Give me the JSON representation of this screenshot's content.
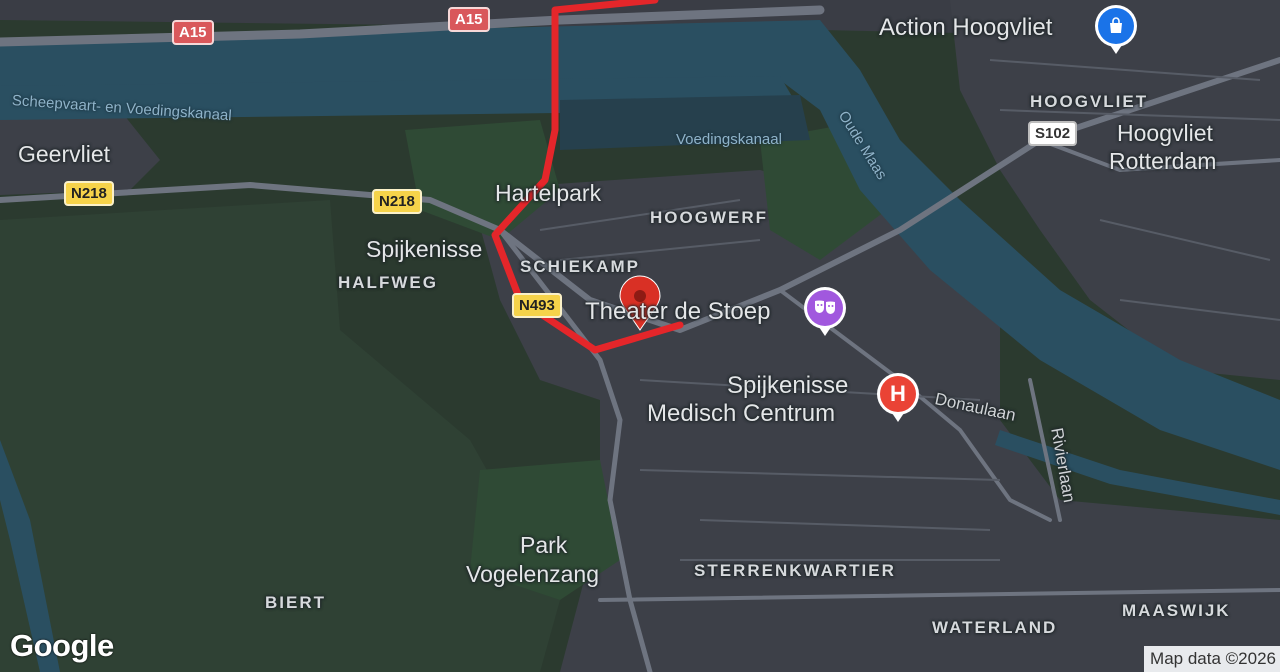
{
  "map": {
    "attribution": "Map data ©2026",
    "logo": "Google",
    "colors": {
      "land": "#2b3a2f",
      "urban": "#3d4048",
      "water": "#2a4f61",
      "road": "#6e7480",
      "route": "#e4262a",
      "marker": "#d93025"
    },
    "places": {
      "geervliet": "Geervliet",
      "hartelpark": "Hartelpark",
      "spijkenisse": "Spijkenisse",
      "hoogvliet_rotterdam_1": "Hoogvliet",
      "hoogvliet_rotterdam_2": "Rotterdam",
      "park_vogelenzang_1": "Park",
      "park_vogelenzang_2": "Vogelenzang"
    },
    "districts": {
      "halfweg": "HALFWEG",
      "schiekamp": "SCHIEKAMP",
      "hoogwerf": "HOOGWERF",
      "hoogvliet": "HOOGVLIET",
      "sterrenkwartier": "STERRENKWARTIER",
      "biert": "BIERT",
      "waterland": "WATERLAND",
      "maaswijk": "MAASWIJK"
    },
    "water": {
      "kanaal": "Scheepvaart- en Voedingskanaal",
      "voedingskanaal": "Voedingskanaal",
      "oude_maas": "Oude Maas"
    },
    "streets": {
      "donaulaan": "Donaulaan",
      "rivierlaan": "Rivierlaan"
    },
    "shields": {
      "a15_left": "A15",
      "a15_right": "A15",
      "n218_left": "N218",
      "n218_right": "N218",
      "n493": "N493",
      "s102": "S102"
    },
    "pois": {
      "action": {
        "name": "Action Hoogvliet",
        "icon": "shopping-bag-icon"
      },
      "theatre": {
        "name": "Theater de Stoep",
        "icon": "theatre-masks-icon"
      },
      "hospital_1": "Spijkenisse",
      "hospital_2": "Medisch Centrum",
      "hospital_icon": "H"
    }
  }
}
